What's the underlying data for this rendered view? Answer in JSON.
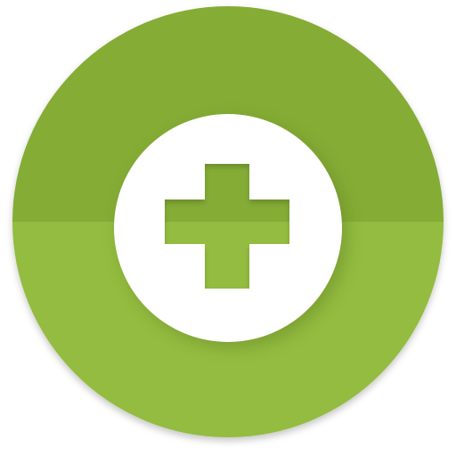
{
  "icon": {
    "name": "plus-icon",
    "colors": {
      "ring_top": "#85ac36",
      "ring_bottom": "#93bc41",
      "center_disc": "#ffffff",
      "plus_top": "#85ac36",
      "plus_bottom": "#93bc41",
      "shadow": "#5e7d22"
    }
  }
}
